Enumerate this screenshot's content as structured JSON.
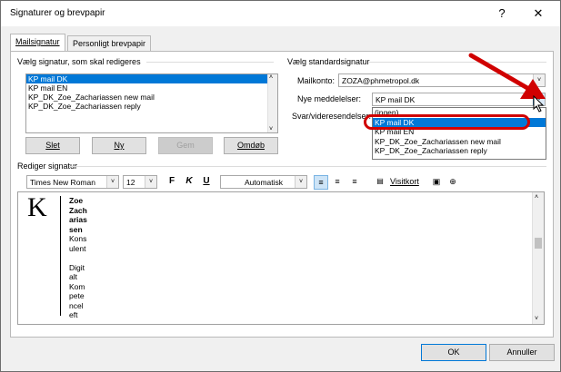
{
  "window": {
    "title": "Signaturer og brevpapir",
    "help": "?",
    "close": "✕"
  },
  "tabs": [
    {
      "label": "Mailsignatur"
    },
    {
      "label": "Personligt brevpapir"
    }
  ],
  "left_group": {
    "title": "Vælg signatur, som skal redigeres",
    "items": [
      "KP mail DK",
      "KP mail EN",
      "KP_DK_Zoe_Zachariassen new mail",
      "KP_DK_Zoe_Zachariassen reply"
    ],
    "selected_index": 0,
    "buttons": {
      "delete": "Slet",
      "new": "Ny",
      "save": "Gem",
      "rename": "Omdøb"
    }
  },
  "right_group": {
    "title": "Vælg standardsignatur",
    "account_label": "Mailkonto:",
    "account_value": "ZOZA@phmetropol.dk",
    "new_label": "Nye meddelelser:",
    "new_value": "KP mail DK",
    "reply_label": "Svar/videresendelser:",
    "dropdown_items": [
      "(ingen)",
      "KP mail DK",
      "KP mail EN",
      "KP_DK_Zoe_Zachariassen new mail",
      "KP_DK_Zoe_Zachariassen reply"
    ],
    "dropdown_selected_index": 1
  },
  "edit_group": {
    "title": "Rediger signatur",
    "font": "Times New Roman",
    "size": "12",
    "bold": "F",
    "italic": "K",
    "underline": "U",
    "color": "Automatisk",
    "vcard": "Visitkort"
  },
  "signature": {
    "logo": "K",
    "lines": [
      "Zoe",
      "Zach",
      "arias",
      "sen",
      "Kons",
      "ulent",
      "",
      "Digit",
      "alt",
      "Kom",
      "pete",
      "ncel",
      "eft"
    ],
    "bold_count": 4
  },
  "footer": {
    "ok": "OK",
    "cancel": "Annuller"
  },
  "colors": {
    "accent": "#0078d7",
    "highlight_oval": "#d00000",
    "arrow": "#d00000"
  }
}
